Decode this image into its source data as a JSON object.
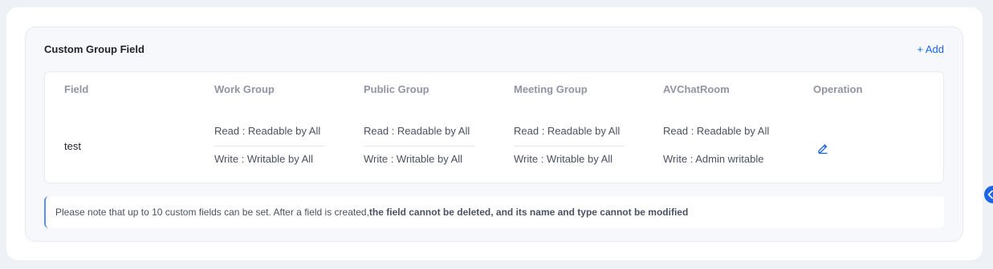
{
  "section": {
    "title": "Custom Group Field",
    "add_label": "+ Add"
  },
  "table": {
    "columns": [
      "Field",
      "Work Group",
      "Public Group",
      "Meeting Group",
      "AVChatRoom",
      "Operation"
    ],
    "rows": [
      {
        "field": "test",
        "work_group": {
          "read": "Read : Readable by All",
          "write": "Write : Writable by All"
        },
        "public_group": {
          "read": "Read : Readable by All",
          "write": "Write : Writable by All"
        },
        "meeting_group": {
          "read": "Read : Readable by All",
          "write": "Write : Writable by All"
        },
        "avchatroom": {
          "read": "Read : Readable by All",
          "write": "Write : Admin writable"
        },
        "operation_icon": "edit-icon"
      }
    ]
  },
  "notice": {
    "text": "Please note that up to 10 custom fields can be set. After a field is created,",
    "emphasis": "the field cannot be deleted, and its name and type cannot be modified"
  },
  "colors": {
    "accent": "#1c66e5",
    "header_text": "#8f95a3",
    "page_bg": "#eef1f6"
  }
}
